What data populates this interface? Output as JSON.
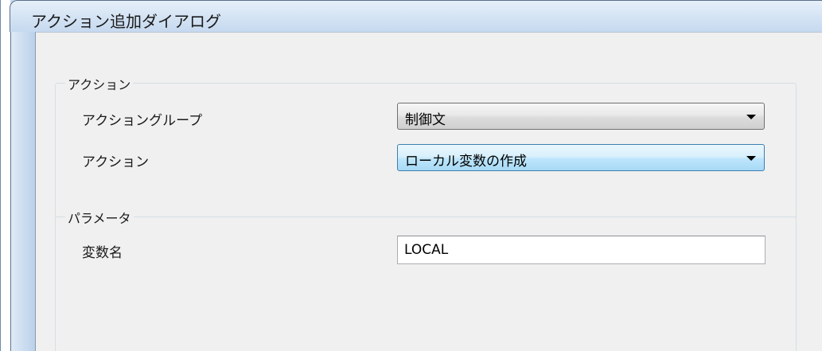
{
  "window": {
    "title": "アクション追加ダイアログ"
  },
  "action_group": {
    "legend": "アクション",
    "group_label": "アクショングループ",
    "group_value": "制御文",
    "action_label": "アクション",
    "action_value": "ローカル変数の作成"
  },
  "parameter_group": {
    "legend": "パラメータ",
    "variable_name_label": "変数名",
    "variable_name_value": "LOCAL"
  },
  "colors": {
    "accent_focus": "#3c7fb1",
    "client_background": "#f0f0f0"
  }
}
